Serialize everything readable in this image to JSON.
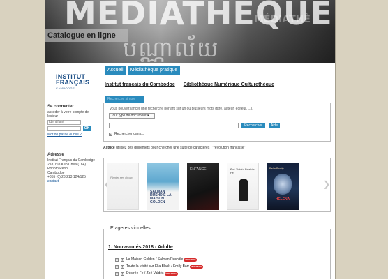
{
  "colors": {
    "accent": "#2a8bbd",
    "background": "#d9d2bf",
    "logo_blue": "#1b4e86",
    "badge_red": "#d62b2b"
  },
  "banner": {
    "word": "MÉDIATHÈQUE",
    "word_small": "MÉDIATHÈ",
    "khmer": "បណ្ណាល័យ",
    "title": "Catalogue en ligne"
  },
  "logo": {
    "line1": "INSTITUT",
    "line2": "FRANÇAIS",
    "line3": "CAMBODGE"
  },
  "nav": {
    "tabs": [
      "Accueil",
      "Médiathèque pratique"
    ],
    "links": [
      "Institut français du Cambodge",
      "Bibliothèque Numérique Culturethèque"
    ]
  },
  "login": {
    "title": "Se connecter",
    "text": "accéder à votre compte de lecteur",
    "id_placeholder": "Identifiant",
    "ok_label": "OK",
    "forgot": "Mot de passe oublié ?"
  },
  "address": {
    "title": "Adresse",
    "lines": [
      "Institut Français du Cambodge",
      "218, rue Kéo Chea (184)",
      "Phnom Penh",
      "Cambodge",
      "+855 (0) 23 213 124/125"
    ],
    "contact": "contact"
  },
  "search": {
    "tab_label": "Recherche simple",
    "hint": "Vous pouvez lancer une recherche portant sur un ou plusieurs mots (titre, auteur, éditeur, ...).",
    "type_value": "Tout type de document",
    "search_button": "Rechercher",
    "help_button": "Aide",
    "more": "Rechercher dans..."
  },
  "tip": {
    "label": "Astuce",
    "text": " utilisez des guillemets pour chercher une suite de caractères : \"révolution française\""
  },
  "carousel": {
    "books": [
      {
        "title": "Planter ses choux"
      },
      {
        "title": "SALMAN RUSHDIE LA MAISON GOLDEN"
      },
      {
        "title": "ENFANCE"
      },
      {
        "title": "Zoé Valdés Désirée Fe"
      },
      {
        "title": "Bella Brody",
        "subtitle": "HELENA"
      }
    ]
  },
  "shelves": {
    "legend": "Etageres virtuelles",
    "shelf_title": "1. Nouveautés 2018 - Adulte",
    "items": [
      {
        "text": "La Maison Golden / Salman Rushdie",
        "badge": "NOUVEAU"
      },
      {
        "text": "Toute la vérité sur Ella Black / Emily Barr",
        "badge": "NOUVEAU"
      },
      {
        "text": "Désirée Fe / Zoé Valdés",
        "badge": "NOUVEAU"
      }
    ]
  }
}
